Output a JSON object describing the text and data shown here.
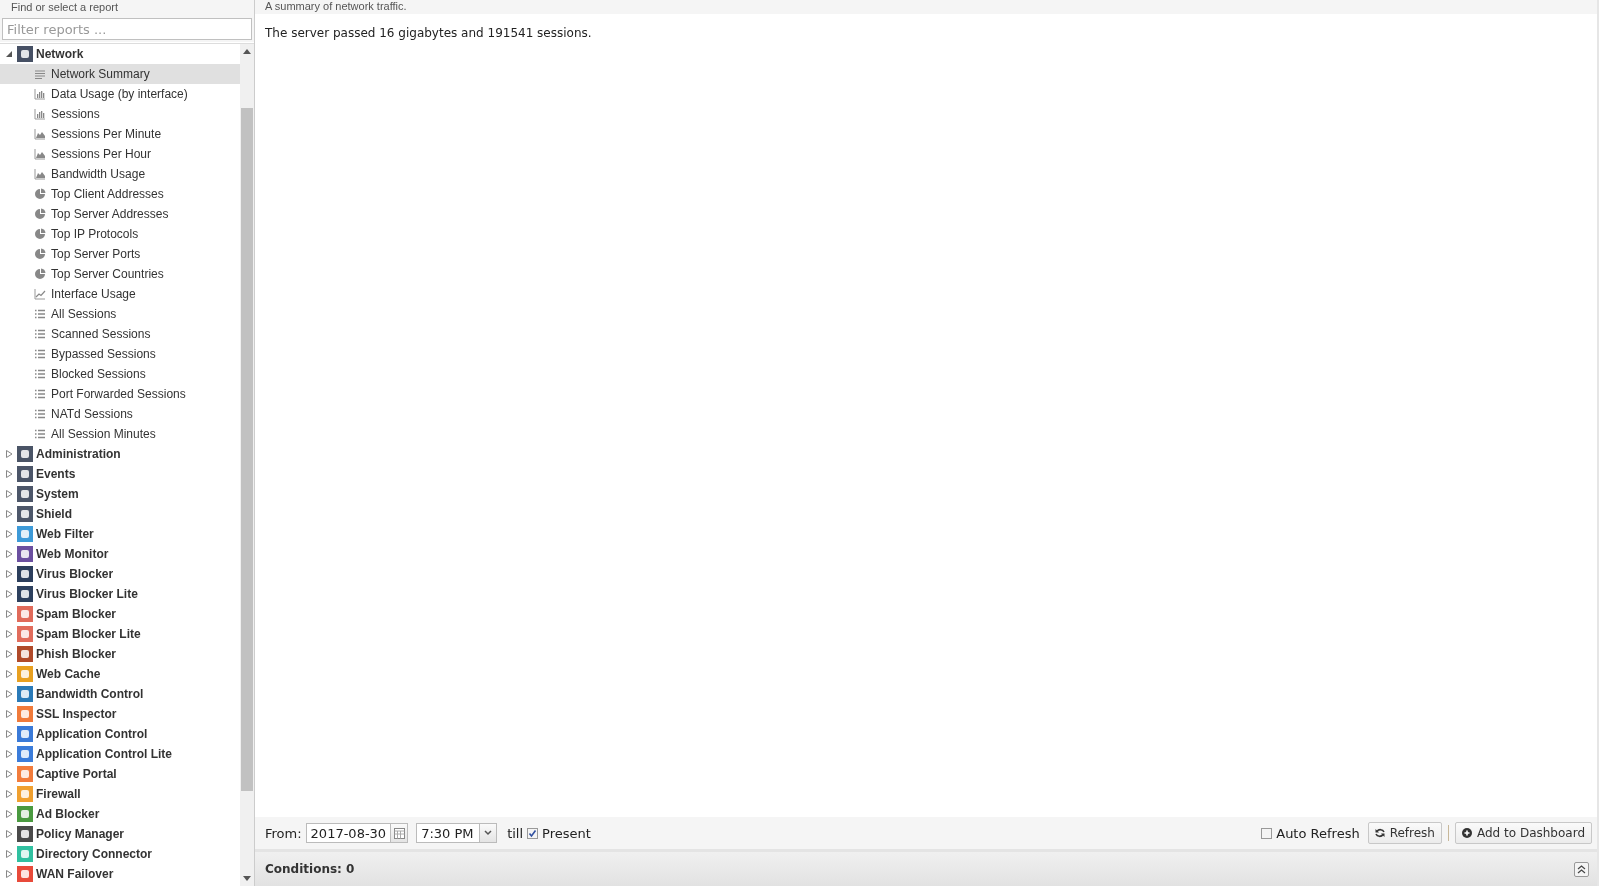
{
  "sidebar": {
    "title": "Find or select a report",
    "filter": {
      "placeholder": "Filter reports ..."
    },
    "categories": [
      {
        "label": "Network",
        "color": "#465064",
        "expanded": true,
        "selected": false,
        "children": [
          {
            "label": "Network Summary",
            "kind": "summary",
            "selected": true
          },
          {
            "label": "Data Usage (by interface)",
            "kind": "bar",
            "selected": false
          },
          {
            "label": "Sessions",
            "kind": "bar",
            "selected": false
          },
          {
            "label": "Sessions Per Minute",
            "kind": "area",
            "selected": false
          },
          {
            "label": "Sessions Per Hour",
            "kind": "area",
            "selected": false
          },
          {
            "label": "Bandwidth Usage",
            "kind": "area",
            "selected": false
          },
          {
            "label": "Top Client Addresses",
            "kind": "pie",
            "selected": false
          },
          {
            "label": "Top Server Addresses",
            "kind": "pie",
            "selected": false
          },
          {
            "label": "Top IP Protocols",
            "kind": "pie",
            "selected": false
          },
          {
            "label": "Top Server Ports",
            "kind": "pie",
            "selected": false
          },
          {
            "label": "Top Server Countries",
            "kind": "pie",
            "selected": false
          },
          {
            "label": "Interface Usage",
            "kind": "line",
            "selected": false
          },
          {
            "label": "All Sessions",
            "kind": "list",
            "selected": false
          },
          {
            "label": "Scanned Sessions",
            "kind": "list",
            "selected": false
          },
          {
            "label": "Bypassed Sessions",
            "kind": "list",
            "selected": false
          },
          {
            "label": "Blocked Sessions",
            "kind": "list",
            "selected": false
          },
          {
            "label": "Port Forwarded Sessions",
            "kind": "list",
            "selected": false
          },
          {
            "label": "NATd Sessions",
            "kind": "list",
            "selected": false
          },
          {
            "label": "All Session Minutes",
            "kind": "list",
            "selected": false
          }
        ]
      },
      {
        "label": "Administration",
        "color": "#4a5466",
        "expanded": false,
        "selected": false
      },
      {
        "label": "Events",
        "color": "#4b5568",
        "expanded": false,
        "selected": false
      },
      {
        "label": "System",
        "color": "#4c5669",
        "expanded": false,
        "selected": false
      },
      {
        "label": "Shield",
        "color": "#4d576a",
        "expanded": false,
        "selected": false
      },
      {
        "label": "Web Filter",
        "color": "#3d9ad8",
        "expanded": false,
        "selected": false
      },
      {
        "label": "Web Monitor",
        "color": "#6b4fa0",
        "expanded": false,
        "selected": false
      },
      {
        "label": "Virus Blocker",
        "color": "#2c3e5c",
        "expanded": false,
        "selected": false
      },
      {
        "label": "Virus Blocker Lite",
        "color": "#2d405e",
        "expanded": false,
        "selected": false
      },
      {
        "label": "Spam Blocker",
        "color": "#e06a5a",
        "expanded": false,
        "selected": false
      },
      {
        "label": "Spam Blocker Lite",
        "color": "#e16c5c",
        "expanded": false,
        "selected": false
      },
      {
        "label": "Phish Blocker",
        "color": "#b04a2a",
        "expanded": false,
        "selected": false
      },
      {
        "label": "Web Cache",
        "color": "#e8a020",
        "expanded": false,
        "selected": false
      },
      {
        "label": "Bandwidth Control",
        "color": "#2a7ab8",
        "expanded": false,
        "selected": false
      },
      {
        "label": "SSL Inspector",
        "color": "#f07a3a",
        "expanded": false,
        "selected": false
      },
      {
        "label": "Application Control",
        "color": "#3a7ad8",
        "expanded": false,
        "selected": false
      },
      {
        "label": "Application Control Lite",
        "color": "#3b7cda",
        "expanded": false,
        "selected": false
      },
      {
        "label": "Captive Portal",
        "color": "#f27c3c",
        "expanded": false,
        "selected": false
      },
      {
        "label": "Firewall",
        "color": "#f0a030",
        "expanded": false,
        "selected": false
      },
      {
        "label": "Ad Blocker",
        "color": "#4a9a40",
        "expanded": false,
        "selected": false
      },
      {
        "label": "Policy Manager",
        "color": "#4a4a4a",
        "expanded": false,
        "selected": false
      },
      {
        "label": "Directory Connector",
        "color": "#30c0a0",
        "expanded": false,
        "selected": false
      },
      {
        "label": "WAN Failover",
        "color": "#e84a3a",
        "expanded": false,
        "selected": false
      }
    ]
  },
  "main": {
    "description": "A summary of network traffic.",
    "summary": "The server passed 16 gigabytes and 191541 sessions.",
    "toolbar": {
      "from_label": "From:",
      "date": "2017-08-30",
      "time": "7:30 PM",
      "till_label": "till",
      "present": {
        "label": "Present",
        "checked": true
      },
      "auto_refresh": {
        "label": "Auto Refresh",
        "checked": false
      },
      "buttons": [
        {
          "label": "Refresh",
          "kind": "refresh"
        },
        {
          "label": "Add to Dashboard",
          "kind": "add"
        }
      ]
    },
    "conditions": {
      "label": "Conditions: 0"
    }
  }
}
